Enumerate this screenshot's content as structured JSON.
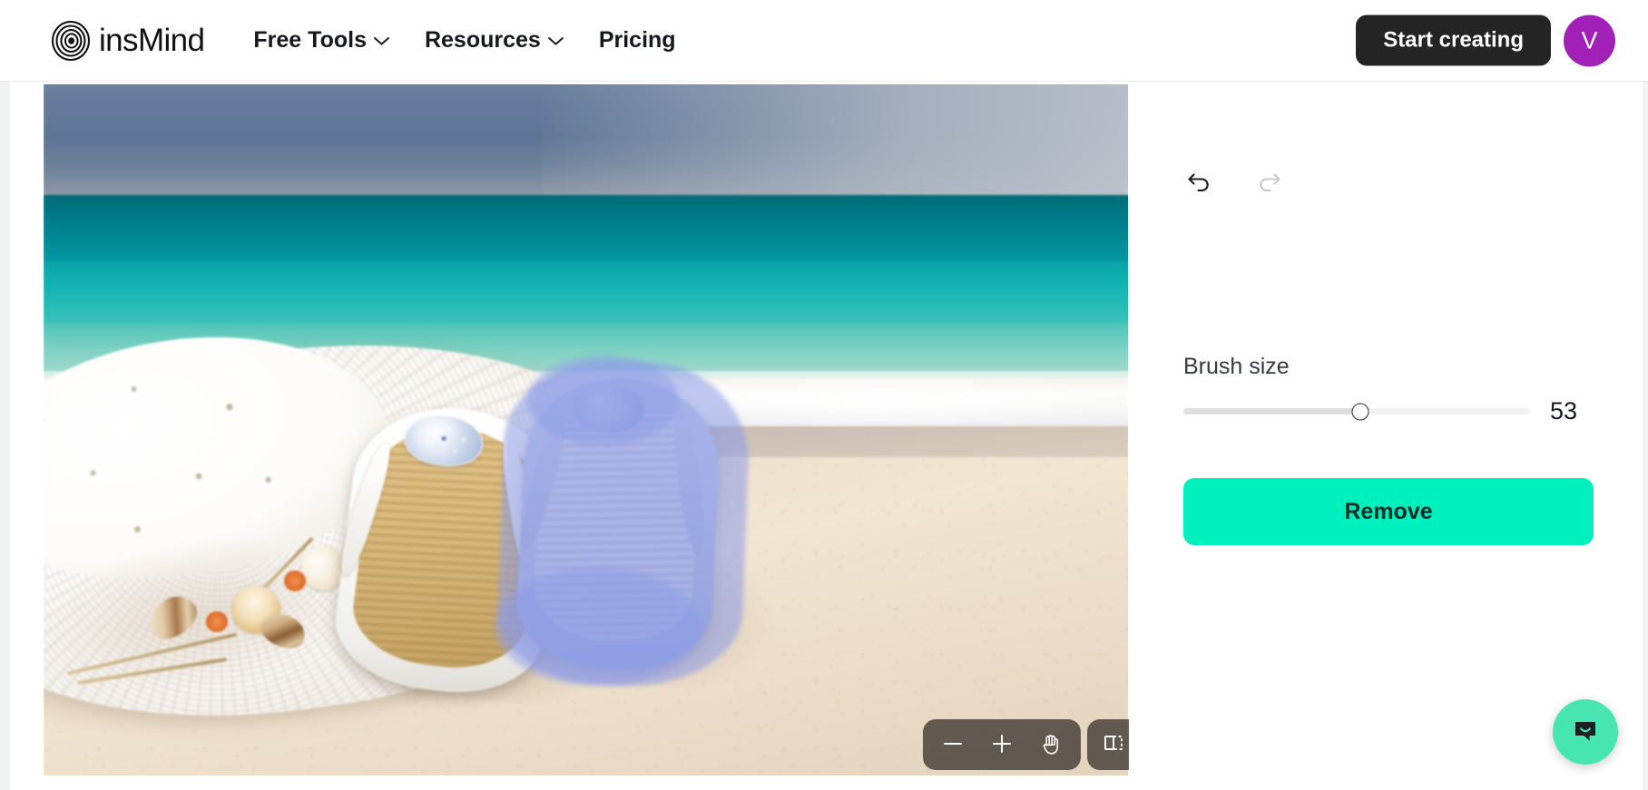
{
  "header": {
    "logo_text": "insMind",
    "logo_icon": "concentric-rings-logo-icon",
    "nav": [
      {
        "label": "Free Tools",
        "has_dropdown": true,
        "icon": "chevron-down-icon"
      },
      {
        "label": "Resources",
        "has_dropdown": true,
        "icon": "chevron-down-icon"
      },
      {
        "label": "Pricing",
        "has_dropdown": false,
        "icon": ""
      }
    ],
    "cta_label": "Start creating",
    "avatar_initial": "V",
    "avatar_color": "#a020b8",
    "cta_color": "#242424"
  },
  "canvas": {
    "image_alt": "Beach scene with white straw sun hat and two flip-flop sandals on sand",
    "brush_mask_color": "#8d9ce8",
    "toolbar": [
      {
        "name": "zoom-out-button",
        "icon": "minus-icon",
        "label": "−"
      },
      {
        "name": "zoom-in-button",
        "icon": "plus-icon",
        "label": "+"
      },
      {
        "name": "pan-tool-button",
        "icon": "hand-icon",
        "label": ""
      },
      {
        "name": "compare-button",
        "icon": "compare-split-icon",
        "label": ""
      }
    ]
  },
  "panel": {
    "undo_label": "Undo",
    "undo_icon": "undo-arrow-icon",
    "undo_enabled": true,
    "redo_label": "Redo",
    "redo_icon": "redo-arrow-icon",
    "redo_enabled": false,
    "brush_size_label": "Brush size",
    "brush_size_value": "53",
    "brush_size_percent": 51,
    "remove_label": "Remove",
    "remove_color": "#00f0bd"
  },
  "chat": {
    "icon": "chat-bubble-smile-icon",
    "color": "#47e6b1"
  }
}
